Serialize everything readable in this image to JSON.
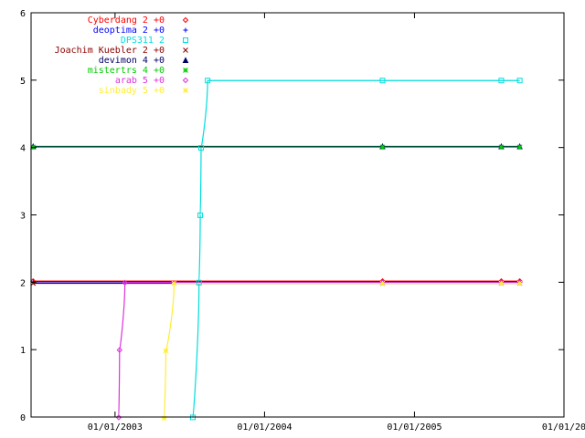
{
  "chart_data": {
    "type": "line",
    "title": "",
    "xlabel": "",
    "ylabel": "",
    "xlim": [
      "2002-06-10",
      "2006-01-01"
    ],
    "ylim": [
      0,
      6
    ],
    "x_ticks": [
      "2003-01-01",
      "2004-01-01",
      "2005-01-01",
      "2006-01-01"
    ],
    "x_tick_labels": [
      "01/01/2003",
      "01/01/2004",
      "01/01/2005",
      "01/01/20"
    ],
    "y_ticks": [
      0,
      1,
      2,
      3,
      4,
      5,
      6
    ],
    "y_tick_labels": [
      "0",
      "1",
      "2",
      "3",
      "4",
      "5",
      "6"
    ],
    "grid": false,
    "legend_position": "top-left",
    "series": [
      {
        "name": "Cyberdang 2 +0",
        "color": "#ff0000",
        "marker": "diamond",
        "points": [
          [
            "2002-06-15",
            2
          ],
          [
            "2004-10-15",
            2
          ],
          [
            "2005-08-01",
            2
          ],
          [
            "2005-09-15",
            2
          ]
        ]
      },
      {
        "name": "deoptima 2 +0",
        "color": "#0000ff",
        "marker": "plus",
        "points": [
          [
            "2002-06-15",
            2
          ],
          [
            "2004-10-15",
            2
          ],
          [
            "2005-08-01",
            2
          ],
          [
            "2005-09-15",
            2
          ]
        ]
      },
      {
        "name": "DPS311 2",
        "color": "#00dddd",
        "marker": "square",
        "points": [
          [
            "2003-07-10",
            0
          ],
          [
            "2003-07-25",
            2
          ],
          [
            "2003-07-28",
            3
          ],
          [
            "2003-07-30",
            4
          ],
          [
            "2003-08-15",
            5
          ],
          [
            "2004-10-15",
            5
          ],
          [
            "2005-08-01",
            5
          ],
          [
            "2005-09-15",
            5
          ]
        ]
      },
      {
        "name": "Joachim Kuebler 2 +0",
        "color": "#8b0000",
        "marker": "cross",
        "points": [
          [
            "2002-06-15",
            2
          ],
          [
            "2004-10-15",
            2
          ],
          [
            "2005-08-01",
            2
          ],
          [
            "2005-09-15",
            2
          ]
        ]
      },
      {
        "name": "devimon 4 +0",
        "color": "#000066",
        "marker": "triangle",
        "points": [
          [
            "2002-06-15",
            4
          ],
          [
            "2004-10-15",
            4
          ],
          [
            "2005-08-01",
            4
          ],
          [
            "2005-09-15",
            4
          ]
        ]
      },
      {
        "name": "mistertrs 4 +0",
        "color": "#00cc00",
        "marker": "star",
        "points": [
          [
            "2002-06-15",
            4
          ],
          [
            "2004-10-15",
            4
          ],
          [
            "2005-08-01",
            4
          ],
          [
            "2005-09-15",
            4
          ]
        ]
      },
      {
        "name": "arab 5 +0",
        "color": "#dd33dd",
        "marker": "diamond",
        "points": [
          [
            "2003-01-10",
            0
          ],
          [
            "2003-01-12",
            1
          ],
          [
            "2003-01-25",
            2
          ],
          [
            "2004-10-15",
            2
          ],
          [
            "2005-08-01",
            2
          ],
          [
            "2005-09-15",
            2
          ]
        ]
      },
      {
        "name": "sinbady 5 +0",
        "color": "#ffee33",
        "marker": "star",
        "points": [
          [
            "2003-05-01",
            0
          ],
          [
            "2003-05-05",
            1
          ],
          [
            "2003-05-25",
            2
          ],
          [
            "2004-10-15",
            2
          ],
          [
            "2005-08-01",
            2
          ],
          [
            "2005-09-15",
            2
          ]
        ]
      }
    ]
  }
}
